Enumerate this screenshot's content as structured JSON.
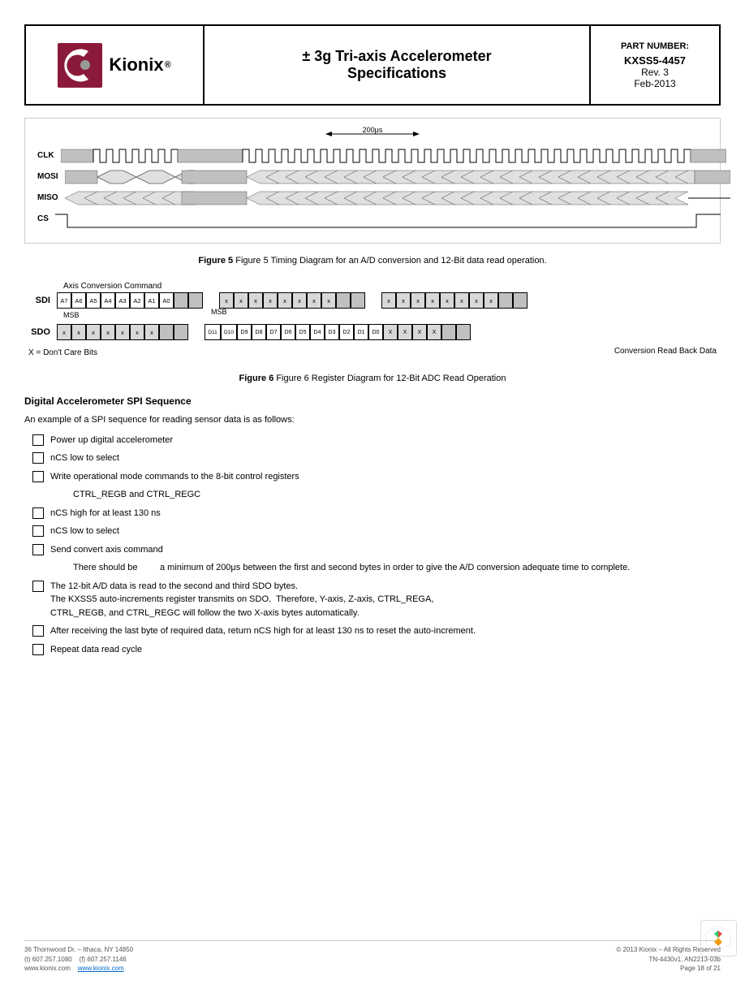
{
  "header": {
    "title_line1": "± 3g Tri-axis  Accelerometer",
    "title_line2": "Specifications",
    "part_label": "PART NUMBER:",
    "part_number": "KXSS5-4457",
    "rev": "Rev. 3",
    "date": "Feb-2013",
    "logo_text": "Kionix",
    "logo_reg": "®"
  },
  "timing_diagram": {
    "time_annotation": "200μs",
    "figure5_caption": "Figure 5 Timing Diagram for an A/D conversion and 12-Bit data read operation."
  },
  "register_diagram": {
    "axis_label": "Axis Conversion Command",
    "msb_label": "MSB",
    "msb_label2": "MSB",
    "sdi_label": "SDI",
    "sdo_label": "SDO",
    "x_label": "X = Don't Care Bits",
    "conversion_label": "Conversion Read Back Data",
    "figure6_caption": "Figure 6 Register Diagram for 12-Bit ADC Read Operation"
  },
  "section": {
    "title": "Digital Accelerometer SPI Sequence",
    "intro": "An example of a SPI sequence for reading sensor data is as follows:",
    "items": [
      {
        "text": "Power up digital accelerometer",
        "indent": false,
        "extra": null
      },
      {
        "text": "nCS low to select",
        "indent": false,
        "extra": null
      },
      {
        "text": "Write operational mode commands to the 8-bit control registers",
        "indent": false,
        "extra": "CTRL_REGB and CTRL_REGC"
      },
      {
        "text": "nCS high for at least 130 ns",
        "indent": false,
        "extra": null
      },
      {
        "text": "nCS low to select",
        "indent": false,
        "extra": null
      },
      {
        "text": "Send convert axis command",
        "indent": false,
        "extra": "There should be      a minimum of 200μs between the first and second bytes in order to give the A/D conversion adequate time to complete."
      },
      {
        "text": "The 12-bit A/D data is read to the second and third SDO bytes.\nThe KXSS5 auto-increments register transmits on SDO.  Therefore, Y-axis, Z-axis, CTRL_REGA,\nCTRL_REGB, and CTRL_REGC will follow the two X-axis bytes automatically.",
        "indent": false,
        "extra": null
      },
      {
        "text": "After receiving the last byte of required data, return nCS high for at least 130 ns to reset the auto-increment.",
        "indent": false,
        "extra": null
      },
      {
        "text": "Repeat data read cycle",
        "indent": false,
        "extra": null
      }
    ]
  },
  "footer": {
    "address": "36 Thornwood Dr. – Ithaca, NY 14850",
    "tel": "(t) 607.257.1080",
    "fax": "(f) 607.257.1146",
    "website": "www.kionix.com",
    "copyright": "© 2013 Kionix – All Rights Reserved",
    "doc_number": "TN-4430v1, AN2213-03b",
    "page": "Page 18 of 21"
  }
}
